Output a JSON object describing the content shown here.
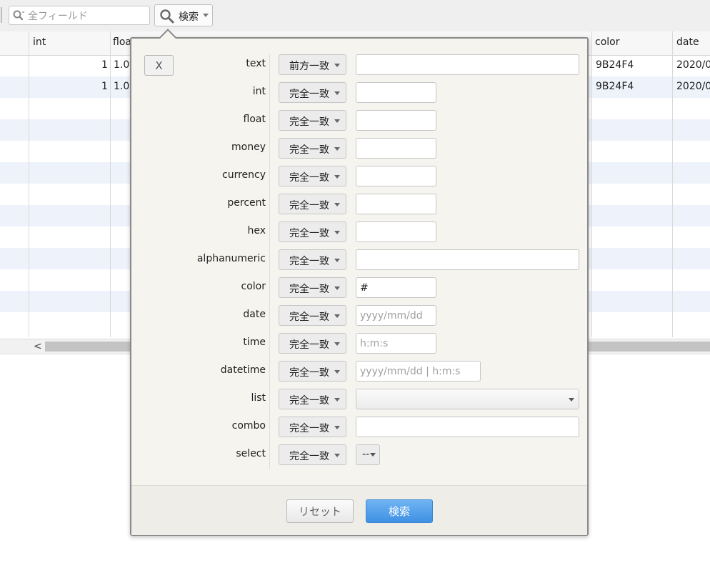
{
  "toolbar": {
    "all_fields_placeholder": "全フィールド",
    "search_button_label": "検索"
  },
  "grid": {
    "headers": {
      "int": "int",
      "float": "floa",
      "color": "color",
      "date": "date"
    },
    "rows": [
      {
        "int": "1",
        "float": "1.0",
        "color": "9B24F4",
        "date": "2020/0"
      },
      {
        "int": "1",
        "float": "1.0",
        "color": "9B24F4",
        "date": "2020/0"
      }
    ]
  },
  "search_panel": {
    "close_label": "X",
    "fields": [
      {
        "label": "text",
        "operator": "前方一致",
        "value": "",
        "placeholder": ""
      },
      {
        "label": "int",
        "operator": "完全一致",
        "value": "",
        "placeholder": ""
      },
      {
        "label": "float",
        "operator": "完全一致",
        "value": "",
        "placeholder": ""
      },
      {
        "label": "money",
        "operator": "完全一致",
        "value": "",
        "placeholder": ""
      },
      {
        "label": "currency",
        "operator": "完全一致",
        "value": "",
        "placeholder": ""
      },
      {
        "label": "percent",
        "operator": "完全一致",
        "value": "",
        "placeholder": ""
      },
      {
        "label": "hex",
        "operator": "完全一致",
        "value": "",
        "placeholder": ""
      },
      {
        "label": "alphanumeric",
        "operator": "完全一致",
        "value": "",
        "placeholder": ""
      },
      {
        "label": "color",
        "operator": "完全一致",
        "value": "#",
        "placeholder": ""
      },
      {
        "label": "date",
        "operator": "完全一致",
        "value": "",
        "placeholder": "yyyy/mm/dd"
      },
      {
        "label": "time",
        "operator": "完全一致",
        "value": "",
        "placeholder": "h:m:s"
      },
      {
        "label": "datetime",
        "operator": "完全一致",
        "value": "",
        "placeholder": "yyyy/mm/dd | h:m:s"
      },
      {
        "label": "list",
        "operator": "完全一致",
        "value": "",
        "placeholder": ""
      },
      {
        "label": "combo",
        "operator": "完全一致",
        "value": "",
        "placeholder": ""
      },
      {
        "label": "select",
        "operator": "完全一致",
        "value": "--",
        "placeholder": ""
      }
    ],
    "reset_label": "リセット",
    "search_label": "検索"
  }
}
